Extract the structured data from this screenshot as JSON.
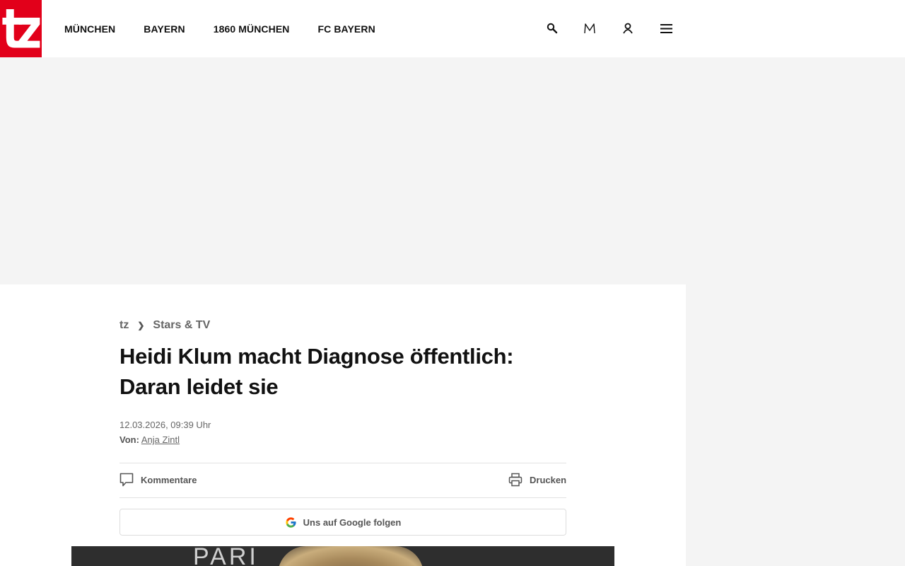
{
  "header": {
    "logo_text": "tz",
    "nav": [
      "MÜNCHEN",
      "BAYERN",
      "1860 MÜNCHEN",
      "FC BAYERN"
    ],
    "icons": [
      "search-icon",
      "m-icon",
      "user-icon",
      "menu-icon"
    ],
    "brand_color": "#e2001a"
  },
  "breadcrumb": {
    "root": "tz",
    "separator": "❯",
    "section": "Stars & TV"
  },
  "article": {
    "headline": "Heidi Klum macht Diagnose öffentlich: Daran leidet sie",
    "date": "12.03.2026, 09:39 Uhr",
    "author_prefix": "Von:",
    "author": "Anja Zintl",
    "comments_label": "Kommentare",
    "print_label": "Drucken",
    "google_follow_label": "Uns auf Google folgen",
    "hero_text": "PARI"
  }
}
